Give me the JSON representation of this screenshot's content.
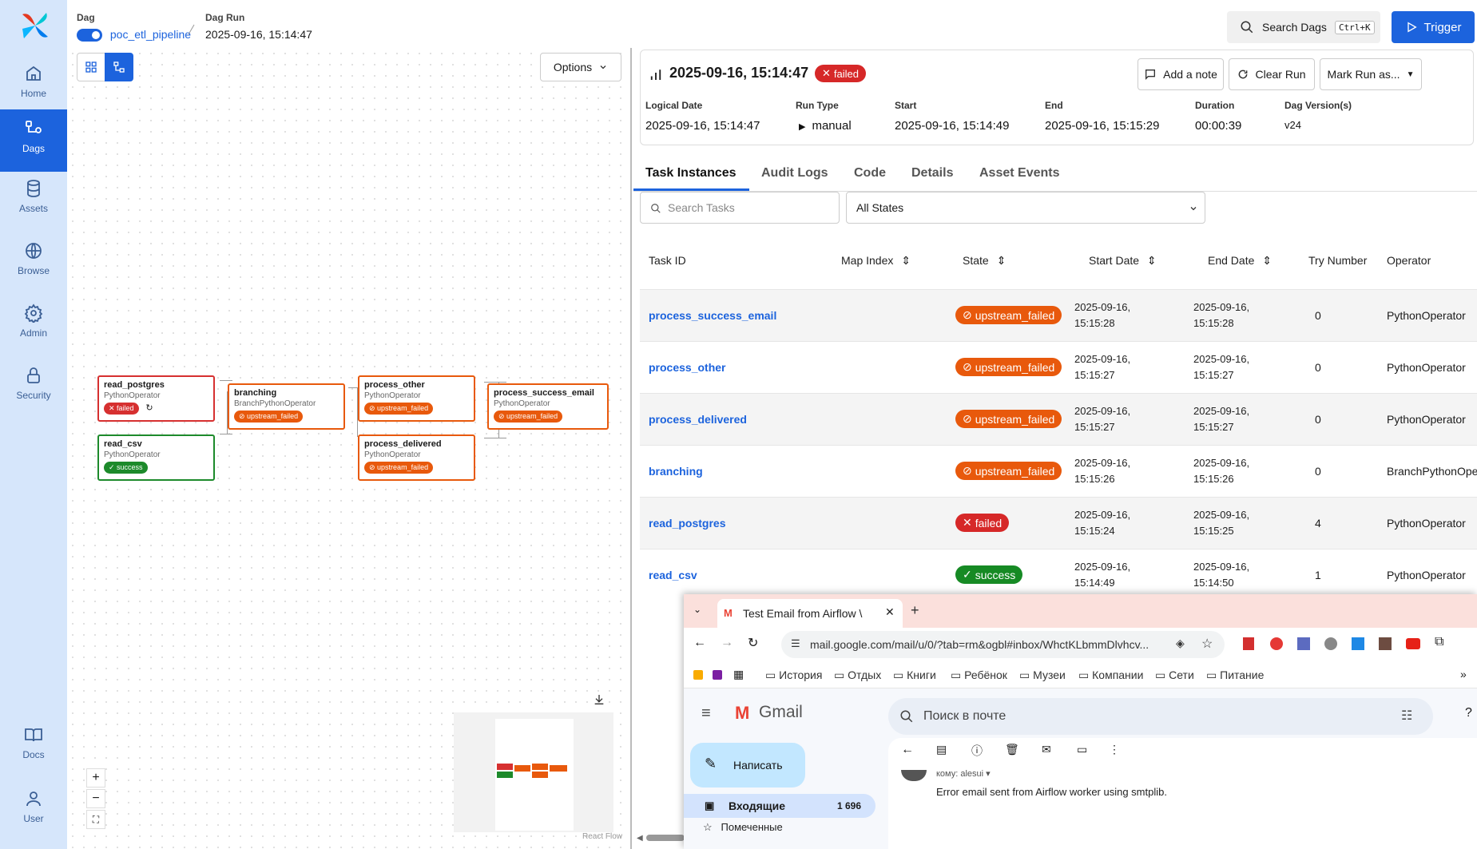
{
  "sidebar": {
    "items": [
      {
        "label": "Home",
        "icon": "home-icon"
      },
      {
        "label": "Dags",
        "icon": "dags-icon"
      },
      {
        "label": "Assets",
        "icon": "database-icon"
      },
      {
        "label": "Browse",
        "icon": "globe-icon"
      },
      {
        "label": "Admin",
        "icon": "gear-icon"
      },
      {
        "label": "Security",
        "icon": "lock-icon"
      },
      {
        "label": "Docs",
        "icon": "book-icon"
      },
      {
        "label": "User",
        "icon": "user-icon"
      }
    ],
    "active": "Dags"
  },
  "header": {
    "dag_label": "Dag",
    "dag_name": "poc_etl_pipeline",
    "dag_run_label": "Dag Run",
    "dag_run_value": "2025-09-16, 15:14:47",
    "search_label": "Search Dags",
    "search_shortcut": "Ctrl+K",
    "trigger_label": "Trigger"
  },
  "graph": {
    "options_label": "Options",
    "react_flow_label": "React Flow",
    "nodes": [
      {
        "name": "read_postgres",
        "operator": "PythonOperator",
        "state": "failed"
      },
      {
        "name": "read_csv",
        "operator": "PythonOperator",
        "state": "success"
      },
      {
        "name": "branching",
        "operator": "BranchPythonOperator",
        "state": "upstream_failed"
      },
      {
        "name": "process_other",
        "operator": "PythonOperator",
        "state": "upstream_failed"
      },
      {
        "name": "process_delivered",
        "operator": "PythonOperator",
        "state": "upstream_failed"
      },
      {
        "name": "process_success_email",
        "operator": "PythonOperator",
        "state": "upstream_failed"
      }
    ]
  },
  "run": {
    "title": "2025-09-16, 15:14:47",
    "state": "failed",
    "add_note": "Add a note",
    "clear_run": "Clear Run",
    "mark_run": "Mark Run as...",
    "meta": {
      "logical_date_label": "Logical Date",
      "logical_date": "2025-09-16, 15:14:47",
      "run_type_label": "Run Type",
      "run_type": "manual",
      "start_label": "Start",
      "start": "2025-09-16, 15:14:49",
      "end_label": "End",
      "end": "2025-09-16, 15:15:29",
      "duration_label": "Duration",
      "duration": "00:00:39",
      "version_label": "Dag Version(s)",
      "version": "v24"
    }
  },
  "tabs": [
    "Task Instances",
    "Audit Logs",
    "Code",
    "Details",
    "Asset Events"
  ],
  "filters": {
    "search_placeholder": "Search Tasks",
    "state_select": "All States"
  },
  "table": {
    "headers": [
      "Task ID",
      "Map Index",
      "State",
      "Start Date",
      "End Date",
      "Try Number",
      "Operator"
    ],
    "rows": [
      {
        "task_id": "process_success_email",
        "state": "upstream_failed",
        "start_d": "2025-09-16,",
        "start_t": "15:15:28",
        "end_d": "2025-09-16,",
        "end_t": "15:15:28",
        "try": "0",
        "operator": "PythonOperator"
      },
      {
        "task_id": "process_other",
        "state": "upstream_failed",
        "start_d": "2025-09-16,",
        "start_t": "15:15:27",
        "end_d": "2025-09-16,",
        "end_t": "15:15:27",
        "try": "0",
        "operator": "PythonOperator"
      },
      {
        "task_id": "process_delivered",
        "state": "upstream_failed",
        "start_d": "2025-09-16,",
        "start_t": "15:15:27",
        "end_d": "2025-09-16,",
        "end_t": "15:15:27",
        "try": "0",
        "operator": "PythonOperator"
      },
      {
        "task_id": "branching",
        "state": "upstream_failed",
        "start_d": "2025-09-16,",
        "start_t": "15:15:26",
        "end_d": "2025-09-16,",
        "end_t": "15:15:26",
        "try": "0",
        "operator": "BranchPythonOpe"
      },
      {
        "task_id": "read_postgres",
        "state": "failed",
        "start_d": "2025-09-16,",
        "start_t": "15:15:24",
        "end_d": "2025-09-16,",
        "end_t": "15:15:25",
        "try": "4",
        "operator": "PythonOperator"
      },
      {
        "task_id": "read_csv",
        "state": "success",
        "start_d": "2025-09-16,",
        "start_t": "15:14:49",
        "end_d": "2025-09-16,",
        "end_t": "15:14:50",
        "try": "1",
        "operator": "PythonOperator"
      }
    ]
  },
  "browser": {
    "tab_title": "Test Email from Airflow \\",
    "url": "mail.google.com/mail/u/0/?tab=rm&ogbl#inbox/WhctKLbmmDlvhcv...",
    "bookmarks": [
      "История",
      "Отдых",
      "Книги",
      "Ребёнок",
      "Музеи",
      "Компании",
      "Сети",
      "Питание"
    ],
    "gmail_label": "Gmail",
    "search_placeholder": "Поиск в почте",
    "compose": "Написать",
    "inbox": "Входящие",
    "inbox_count": "1 696",
    "starred": "Помеченные",
    "to_line": "кому: alesui",
    "body": "Error email sent from Airflow worker using smtplib."
  },
  "colors": {
    "primary": "#1c63dd",
    "failed": "#d62828",
    "upstream_failed": "#e8590c",
    "success": "#168a24",
    "sidebar_bg": "#d6e6fb"
  }
}
